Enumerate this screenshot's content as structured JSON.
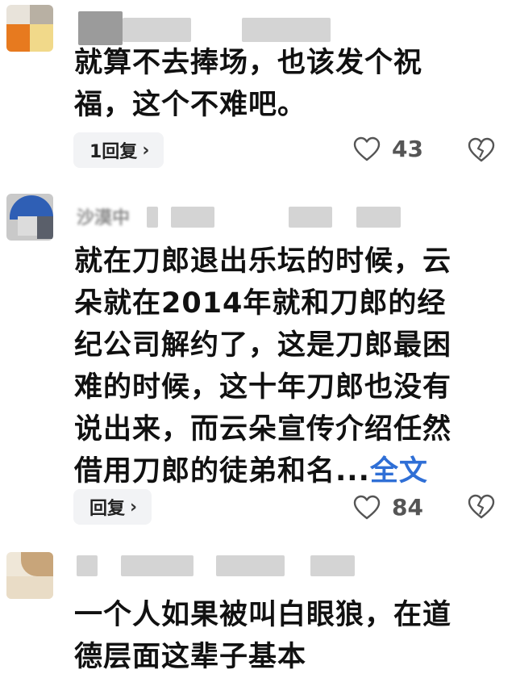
{
  "comments": [
    {
      "text_lines": [
        "就算不去捧场，也该发个祝",
        "福，这个不难吧。"
      ],
      "reply_label": "1回复",
      "like_count": "43"
    },
    {
      "author_fragment": "沙漠中",
      "text_lines": [
        "就在刀郎退出乐坛的时候，云",
        "朵就在2014年就和刀郎的经",
        "纪公司解约了，这是刀郎最困",
        "难的时候，这十年刀郎也没有",
        "说出来，而云朵宣传介绍任然"
      ],
      "last_line": "借用刀郎的徒弟和名...",
      "full_text_link": "全文",
      "reply_label": "回复",
      "like_count": "84"
    },
    {
      "text_lines": [
        "一个人如果被叫白眼狼，在道",
        "德层面这辈子基本"
      ]
    }
  ],
  "colors": {
    "link": "#2f6fd6",
    "pill_bg": "#f2f3f5",
    "text": "#111111",
    "count": "#555555"
  },
  "icons": [
    "heart-icon",
    "broken-heart-icon",
    "chevron-right-icon"
  ]
}
